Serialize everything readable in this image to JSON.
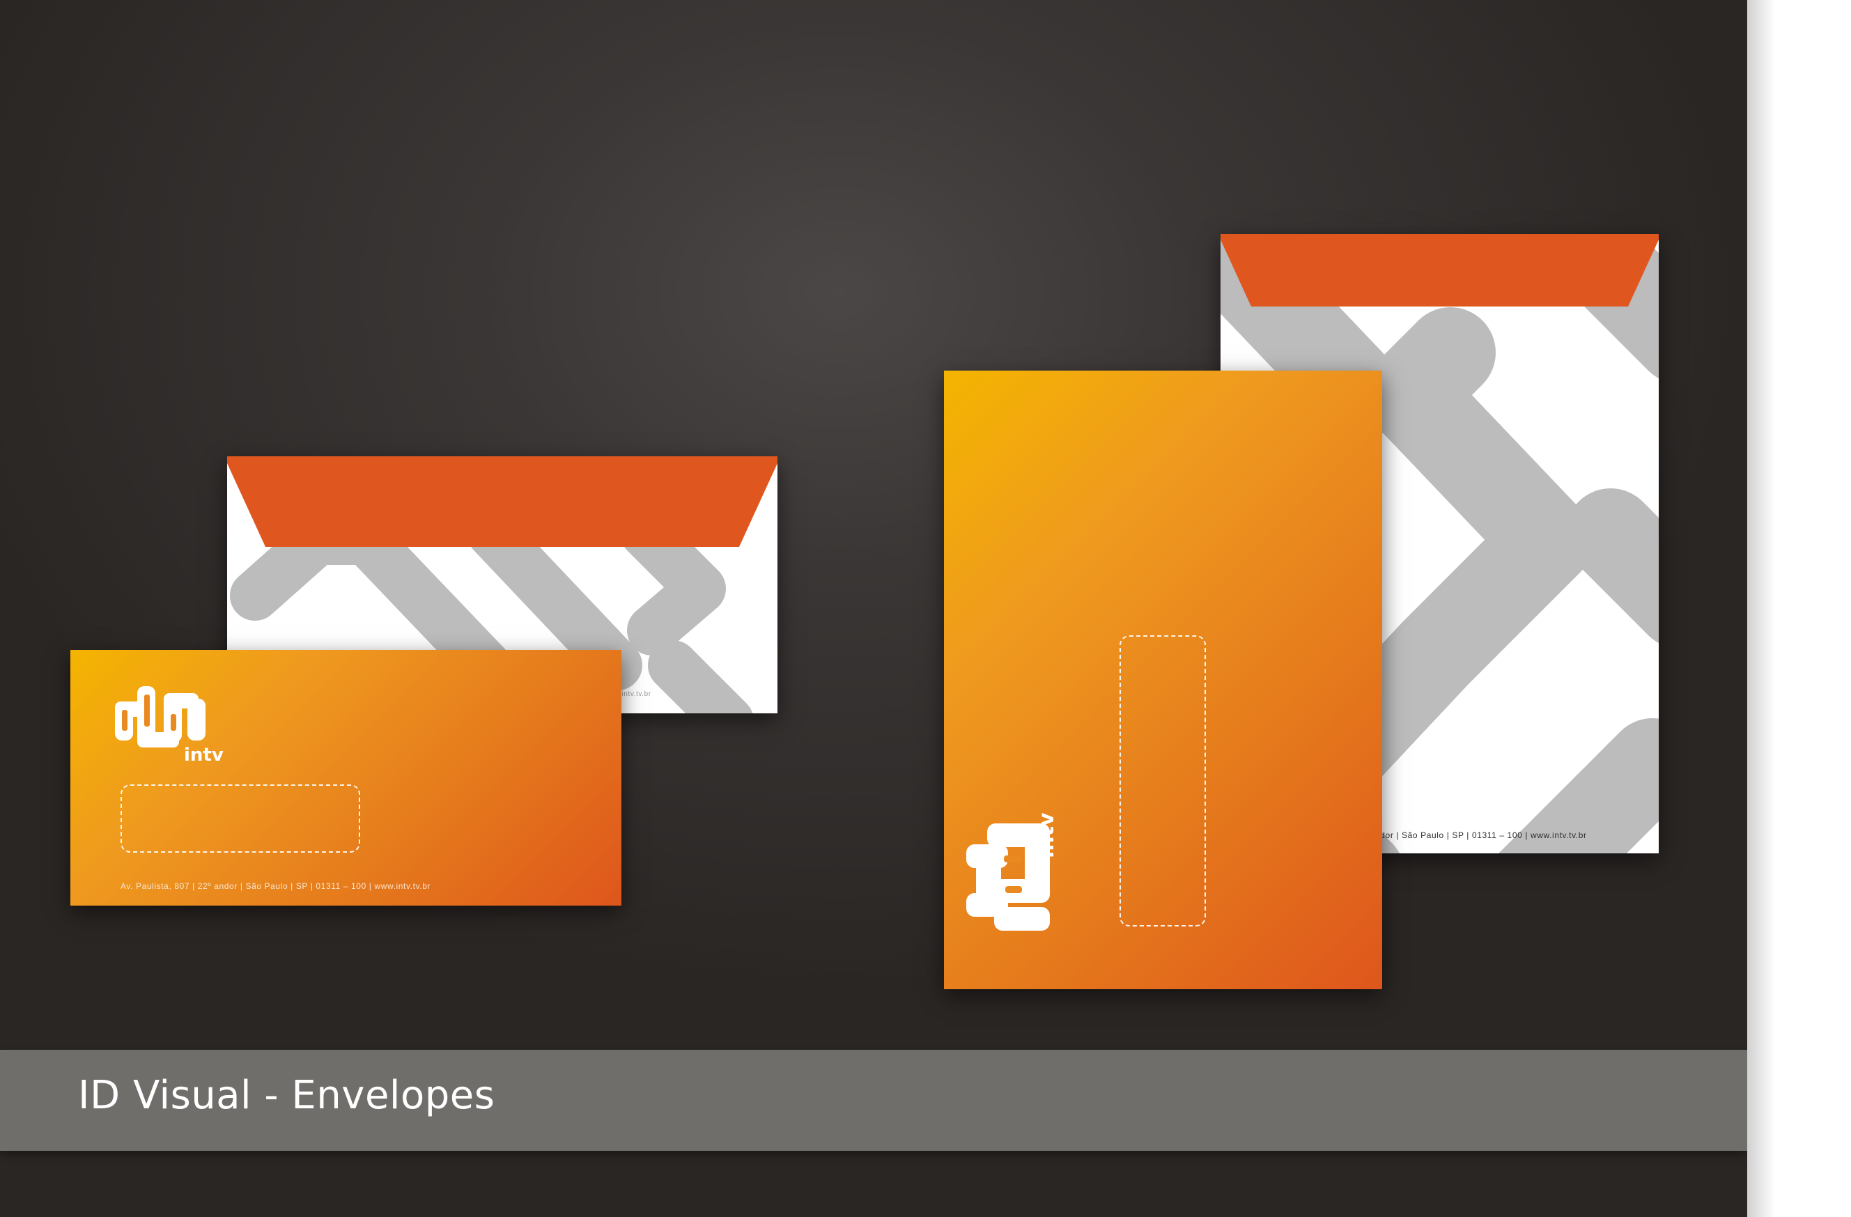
{
  "banner": {
    "title": "ID Visual - Envelopes"
  },
  "brand": {
    "name": "intv"
  },
  "small_envelope": {
    "address": "Av. Paulista, 807  |  22º andor  |  São Paulo | SP | 01311 – 100 | www.intv.tv.br",
    "back_address": "ww.intv.tv.br"
  },
  "large_envelope": {
    "back_address": "ndor  |  São Paulo | SP | 01311 – 100 | www.intv.tv.br"
  },
  "colors": {
    "background": "#2f2b29",
    "flap": "#e0561f",
    "gradient_start": "#f4b400",
    "gradient_end": "#de561c",
    "pattern": "#bcbcbc",
    "banner": "#706e6b"
  }
}
